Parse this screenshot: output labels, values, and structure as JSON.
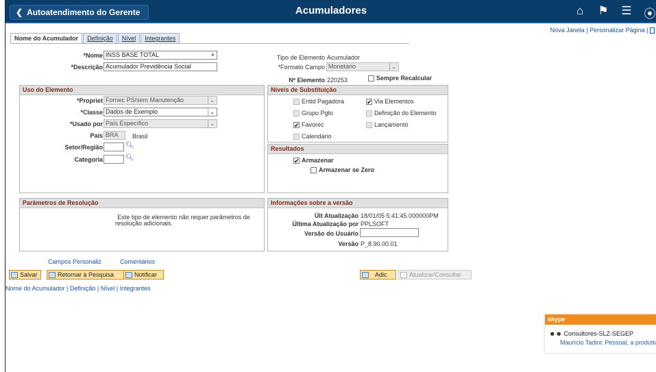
{
  "header": {
    "back_label": "Autoatendimento do Gerente",
    "title": "Acumuladores",
    "icons": [
      "home-icon",
      "flag-icon",
      "menu-icon",
      "navigator-icon"
    ]
  },
  "toplinks": {
    "new_window": "Nova Janela",
    "separator": "|",
    "customize": "Personalizar Página",
    "sep2": "|"
  },
  "tabs": [
    "Nome do Acumulador",
    "Definição",
    "Nível",
    "Integrantes"
  ],
  "form": {
    "nome_label": "*Nome",
    "nome_value": "INSS BASE TOTAL",
    "descricao_label": "*Descrição",
    "descricao_value": "Acumulador Previdência Social",
    "tipo_label": "Tipo de Elemento",
    "tipo_value": "Acumulador",
    "formato_label": "*Formato Campo",
    "formato_value": "Monetário",
    "nelemento_label": "Nº Elemento",
    "nelemento_value": "220253",
    "sempre_recalcular": "Sempre Recalcular"
  },
  "uso": {
    "title": "Uso do Elemento",
    "propriet_label": "*Propriet",
    "propriet_value": "Fornec PS/sem Manutenção",
    "classe_label": "*Classe",
    "classe_value": "Dados de Exemplo",
    "usado_label": "*Usado por",
    "usado_value": "País Específico",
    "pais_label": "País",
    "pais_code": "BRA",
    "pais_name": "Brasil",
    "setor_label": "Setor/Região",
    "categoria_label": "Categoria"
  },
  "niveis": {
    "title": "Níveis de Substituição",
    "items": [
      {
        "label": "Entid Pagadora",
        "checked": false,
        "disabled": true
      },
      {
        "label": "Via Elementos",
        "checked": true,
        "disabled": false
      },
      {
        "label": "Grupo Pgto",
        "checked": false,
        "disabled": true
      },
      {
        "label": "Definição do Elemento",
        "checked": false,
        "disabled": true
      },
      {
        "label": "Favorec",
        "checked": true,
        "disabled": false
      },
      {
        "label": "Lançamento",
        "checked": false,
        "disabled": true
      },
      {
        "label": "Calendário",
        "checked": false,
        "disabled": true
      }
    ]
  },
  "resultados": {
    "title": "Resultados",
    "armazenar": "Armazenar",
    "armazenar_zero": "Armazenar se Zero"
  },
  "parametros": {
    "title": "Parâmetros de Resolução",
    "text1": "Este tipo de elemento não requer parâmetros de",
    "text2": "resolução adicionais."
  },
  "versao": {
    "title": "Informações sobre a versão",
    "ult_label": "Últ Atualização",
    "ult_value": "18/01/05  5:41:45.000000PM",
    "ultpor_label": "Última Atualização por",
    "ultpor_value": "PPLSOFT",
    "versao_usuario_label": "Versão do Usuário",
    "versao_label": "Versão",
    "versao_value": "P_8.90.00.01"
  },
  "bottom_links": {
    "campos": "Campos Personaliz",
    "comentarios": "Comentários"
  },
  "buttons": {
    "salvar": "Salvar",
    "retornar": "Retornar à Pesquisa",
    "notificar": "Notificar",
    "adic": "Adic",
    "atualizar": "Atualizar/Consultar"
  },
  "footer_nav": [
    "Nome do Acumulador",
    "Definição",
    "Nível",
    "Integrantes"
  ],
  "skype": {
    "brand": "skype",
    "group": "Consultores-SLZ-SEGEP",
    "message": "Maurício Tadini: Pessoal, a produtiv..."
  },
  "colors": {
    "header_bg": "#0b3d6b",
    "link": "#1a52a8",
    "group_title": "#7a2f1a",
    "button": "#fbe3a5",
    "skype": "#f08c1e"
  }
}
